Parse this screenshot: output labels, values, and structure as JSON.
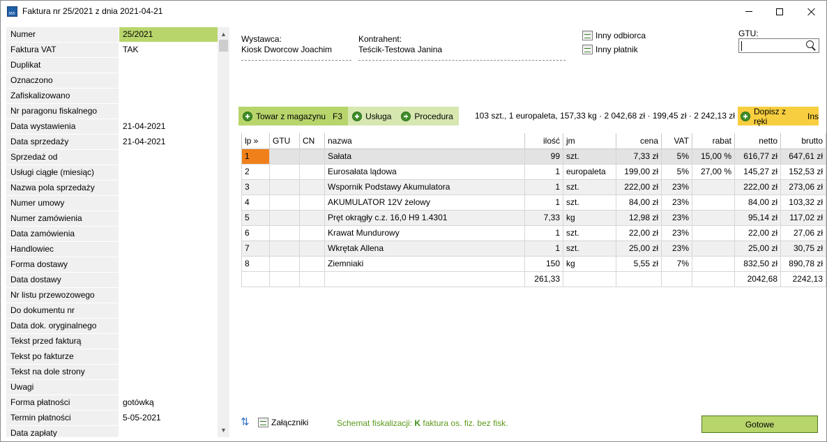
{
  "window": {
    "title": "Faktura nr 25/2021 z dnia 2021-04-21"
  },
  "props": [
    {
      "label": "Numer",
      "value": "25/2021"
    },
    {
      "label": "Faktura VAT",
      "value": "TAK"
    },
    {
      "label": "Duplikat",
      "value": ""
    },
    {
      "label": "Oznaczono",
      "value": ""
    },
    {
      "label": "Zafiskalizowano",
      "value": ""
    },
    {
      "label": "Nr paragonu fiskalnego",
      "value": ""
    },
    {
      "label": "Data wystawienia",
      "value": "21-04-2021"
    },
    {
      "label": "Data sprzedaży",
      "value": "21-04-2021"
    },
    {
      "label": "Sprzedaż od",
      "value": ""
    },
    {
      "label": "Usługi ciągłe (miesiąc)",
      "value": ""
    },
    {
      "label": "Nazwa pola sprzedaży",
      "value": ""
    },
    {
      "label": "Numer umowy",
      "value": ""
    },
    {
      "label": "Numer zamówienia",
      "value": ""
    },
    {
      "label": "Data zamówienia",
      "value": ""
    },
    {
      "label": "Handlowiec",
      "value": ""
    },
    {
      "label": "Forma dostawy",
      "value": ""
    },
    {
      "label": "Data dostawy",
      "value": ""
    },
    {
      "label": "Nr listu przewozowego",
      "value": ""
    },
    {
      "label": "Do dokumentu nr",
      "value": ""
    },
    {
      "label": "Data dok. oryginalnego",
      "value": ""
    },
    {
      "label": "Tekst przed fakturą",
      "value": ""
    },
    {
      "label": "Tekst po fakturze",
      "value": ""
    },
    {
      "label": "Tekst na dole strony",
      "value": ""
    },
    {
      "label": "Uwagi",
      "value": ""
    },
    {
      "label": "Forma płatności",
      "value": "gotówką"
    },
    {
      "label": "Termin płatności",
      "value": "5-05-2021"
    },
    {
      "label": "Data zapłaty",
      "value": ""
    }
  ],
  "header": {
    "issuer_label": "Wystawca:",
    "issuer": "Kiosk Dworcow Joachim",
    "contractor_label": "Kontrahent:",
    "contractor": "Teścik-Testowa Janina",
    "other_recipient": "Inny odbiorca",
    "other_payer": "Inny płatnik",
    "gtu_label": "GTU:",
    "gtu_value": ""
  },
  "toolbar": {
    "goods_label": "Towar z magazynu",
    "goods_key": "F3",
    "service_label": "Usługa",
    "procedure_label": "Procedura",
    "summary": "103 szt., 1 europaleta, 157,33 kg · 2 042,68 zł · 199,45 zł · 2 242,13 zł",
    "add_hand_label": "Dopisz z ręki",
    "add_hand_key": "Ins"
  },
  "table": {
    "columns": [
      "lp »",
      "GTU",
      "CN",
      "nazwa",
      "ilość",
      "jm",
      "cena",
      "VAT",
      "rabat",
      "netto",
      "brutto"
    ],
    "rows": [
      {
        "lp": "1",
        "gtu": "",
        "cn": "",
        "nazwa": "Sałata",
        "ilosc": "99",
        "jm": "szt.",
        "cena": "7,33 zł",
        "vat": "5%",
        "rabat": "15,00 %",
        "netto": "616,77 zł",
        "brutto": "647,61 zł"
      },
      {
        "lp": "2",
        "gtu": "",
        "cn": "",
        "nazwa": "Eurosałata lądowa",
        "ilosc": "1",
        "jm": "europaleta",
        "cena": "199,00 zł",
        "vat": "5%",
        "rabat": "27,00 %",
        "netto": "145,27 zł",
        "brutto": "152,53 zł"
      },
      {
        "lp": "3",
        "gtu": "",
        "cn": "",
        "nazwa": "Wspornik Podstawy Akumulatora",
        "ilosc": "1",
        "jm": "szt.",
        "cena": "222,00 zł",
        "vat": "23%",
        "rabat": "",
        "netto": "222,00 zł",
        "brutto": "273,06 zł"
      },
      {
        "lp": "4",
        "gtu": "",
        "cn": "",
        "nazwa": "AKUMULATOR  12V  żelowy",
        "ilosc": "1",
        "jm": "szt.",
        "cena": "84,00 zł",
        "vat": "23%",
        "rabat": "",
        "netto": "84,00 zł",
        "brutto": "103,32 zł"
      },
      {
        "lp": "5",
        "gtu": "",
        "cn": "",
        "nazwa": "Pręt okrągły c.z. 16,0 H9 1.4301",
        "ilosc": "7,33",
        "jm": "kg",
        "cena": "12,98 zł",
        "vat": "23%",
        "rabat": "",
        "netto": "95,14 zł",
        "brutto": "117,02 zł"
      },
      {
        "lp": "6",
        "gtu": "",
        "cn": "",
        "nazwa": "Krawat  Mundurowy",
        "ilosc": "1",
        "jm": "szt.",
        "cena": "22,00 zł",
        "vat": "23%",
        "rabat": "",
        "netto": "22,00 zł",
        "brutto": "27,06 zł"
      },
      {
        "lp": "7",
        "gtu": "",
        "cn": "",
        "nazwa": "Wkrętak Allena",
        "ilosc": "1",
        "jm": "szt.",
        "cena": "25,00 zł",
        "vat": "23%",
        "rabat": "",
        "netto": "25,00 zł",
        "brutto": "30,75 zł"
      },
      {
        "lp": "8",
        "gtu": "",
        "cn": "",
        "nazwa": "Ziemniaki",
        "ilosc": "150",
        "jm": "kg",
        "cena": "5,55 zł",
        "vat": "7%",
        "rabat": "",
        "netto": "832,50 zł",
        "brutto": "890,78 zł"
      }
    ],
    "totals": {
      "ilosc": "261,33",
      "netto": "2042,68",
      "brutto": "2242,13"
    }
  },
  "footer": {
    "attachments_label": "Załączniki",
    "fiscal_prefix": "Schemat fiskalizacji:",
    "fiscal_code": "K",
    "fiscal_text": "faktura os. fiz. bez fisk.",
    "ok_label": "Gotowe"
  },
  "colors": {
    "accent_green": "#b8d56c",
    "light_green": "#d6e7b0",
    "yellow": "#f7ce3f",
    "selected_lp": "#f08019"
  }
}
